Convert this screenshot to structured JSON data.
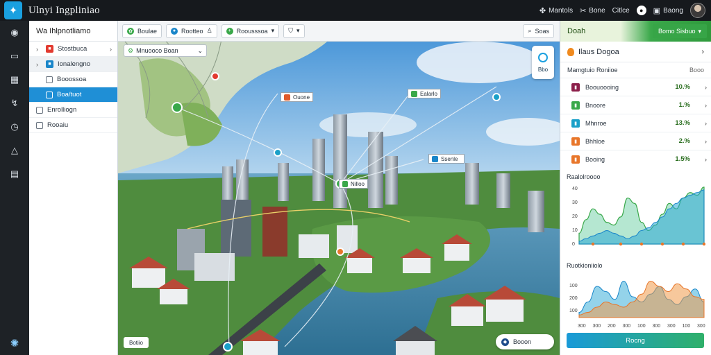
{
  "app": {
    "title": "Ulnyi Ingpliniao"
  },
  "topbar": {
    "items": [
      {
        "label": "Mantols",
        "icon": "puzzle-icon"
      },
      {
        "label": "Bone",
        "icon": "wrench-icon"
      },
      {
        "label": "Citlce",
        "icon": ""
      },
      {
        "label": "",
        "icon": "user-circle-icon"
      },
      {
        "label": "Baong",
        "icon": "lock-icon"
      }
    ]
  },
  "rail": {
    "icons": [
      "compass-icon",
      "monitor-icon",
      "grid-icon",
      "route-icon",
      "clock-icon",
      "warning-icon",
      "layers-icon",
      "globe-icon"
    ]
  },
  "layers": {
    "title": "Wa Ihlpnotliamo",
    "items": [
      {
        "label": "Stostbuca",
        "type": "expand",
        "color": "#e23a2f"
      },
      {
        "label": "Ionalengno",
        "type": "expand",
        "color": "#1a86c9"
      },
      {
        "label": "Booossoa",
        "type": "check",
        "color": ""
      },
      {
        "label": "Boa/tuot",
        "type": "active",
        "color": ""
      },
      {
        "label": "Enrolliogn",
        "type": "check",
        "color": ""
      },
      {
        "label": "Rooaiu",
        "type": "check",
        "color": ""
      }
    ]
  },
  "toolbar": {
    "items": [
      {
        "label": "Boulae",
        "color": "#3aa84a",
        "icon": "leaf-icon"
      },
      {
        "label": "Rootteo",
        "color": "#1a86c9",
        "icon": "pin-icon"
      },
      {
        "label": "Roousssoa",
        "color": "#3aa84a",
        "icon": "plus-icon"
      },
      {
        "label": "",
        "color": "",
        "icon": "filter-icon"
      }
    ],
    "search_label": "Soas"
  },
  "map": {
    "search_text": "Mnuooco Boan",
    "callouts": [
      {
        "label": "Ouone",
        "color": "#e05a2a"
      },
      {
        "label": "Ealarlo",
        "color": "#3aa84a"
      },
      {
        "label": "Ssenle",
        "color": "#1a86c9"
      },
      {
        "label": "Nilloo",
        "color": "#3aa84a"
      }
    ],
    "control_label": "Bbo",
    "badge": "Botiio",
    "button_label": "Booon"
  },
  "right": {
    "header": {
      "label": "Doah",
      "tab": "Bomo Sisbuo"
    },
    "title": "Ilaus Dogoa",
    "sub_label": "Mamgtuio Roniioe",
    "sub_value": "Booo",
    "metrics": [
      {
        "label": "Boouoooing",
        "value": "10.%",
        "color": "#8c1f4a"
      },
      {
        "label": "Bnoore",
        "value": "1.%",
        "color": "#3aa84a"
      },
      {
        "label": "Mhnroe",
        "value": "13.%",
        "color": "#1aa0c8"
      },
      {
        "label": "Bhhloe",
        "value": "2.%",
        "color": "#e8762a"
      },
      {
        "label": "Booing",
        "value": "1.5%",
        "color": "#e8762a"
      }
    ],
    "chart1": {
      "title": "Raalolroooo",
      "ylabels": [
        "40",
        "30",
        "20",
        "10",
        "0"
      ]
    },
    "chart2": {
      "title": "Ruotkioniiolo",
      "ylabels": [
        "100",
        "200",
        "100"
      ],
      "xlabels": [
        "300",
        "300",
        "200",
        "300",
        "100",
        "300",
        "300",
        "100",
        "300"
      ]
    },
    "action": "Rocng"
  },
  "chart_data": [
    {
      "type": "area",
      "title": "Raalolroooo",
      "ylim": [
        0,
        40
      ],
      "series": [
        {
          "values": [
            8,
            18,
            26,
            22,
            16,
            14,
            20,
            34,
            30,
            16,
            10,
            14,
            22,
            30,
            26,
            34,
            38,
            36,
            42
          ]
        },
        {
          "values": [
            2,
            4,
            6,
            8,
            10,
            8,
            6,
            4,
            6,
            10,
            12,
            16,
            20,
            26,
            30,
            34,
            36,
            38,
            40
          ]
        }
      ]
    },
    {
      "type": "area",
      "title": "Ruotkioniiolo",
      "series": [
        {
          "values": [
            10,
            30,
            60,
            50,
            35,
            70,
            40,
            30,
            45,
            60,
            35,
            25,
            40,
            55,
            30
          ]
        },
        {
          "values": [
            5,
            10,
            20,
            30,
            25,
            20,
            30,
            45,
            70,
            60,
            50,
            65,
            55,
            40,
            35
          ]
        }
      ]
    }
  ]
}
